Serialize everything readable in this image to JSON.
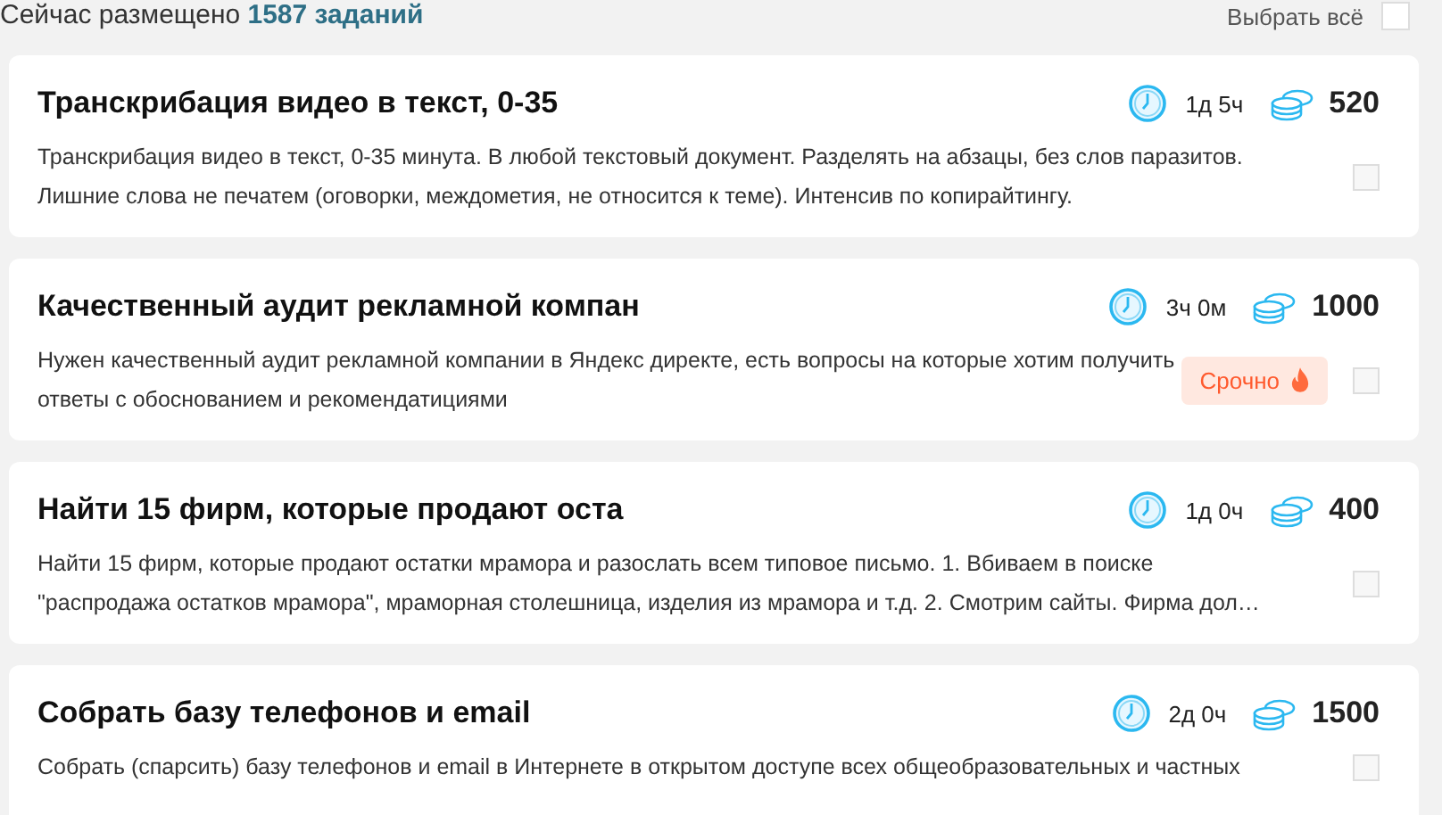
{
  "header": {
    "prefix": "Сейчас размещено",
    "count": "1587 заданий",
    "select_all": {
      "label": "Выбрать всё",
      "checked": false
    }
  },
  "tasks": [
    {
      "title": "Транскрибация видео в текст, 0-35",
      "time": "1д 5ч",
      "price": "520",
      "description": "Транскрибация видео в текст, 0-35 минута. В любой текстовый документ. Разделять на абзацы, без слов паразитов. Лишние слова не печатем (оговорки, междометия, не относится к теме). Интенсив по копирайтингу.",
      "checked": false
    },
    {
      "title": "Качественный аудит рекламной компан",
      "time": "3ч 0м",
      "price": "1000",
      "description": "Нужен качественный аудит рекламной компании в Яндекс директе, есть вопросы на которые хотим получить ответы с обоснованием и рекомендатициями",
      "badge": "Срочно",
      "checked": false
    },
    {
      "title": "Найти 15 фирм, которые продают оста",
      "time": "1д 0ч",
      "price": "400",
      "description": "Найти 15 фирм, которые продают остатки мрамора и разослать всем типовое письмо. 1. Вбиваем в поиске \"распродажа остатков мрамора\", мраморная столешница, изделия из мрамора и т.д. 2. Смотрим сайты. Фирма дол…",
      "checked": false
    },
    {
      "title": "Собрать базу телефонов и email",
      "time": "2д 0ч",
      "price": "1500",
      "description": "Собрать (спарсить) базу телефонов и email в Интернете в открытом доступе всех общеобразовательных и частных",
      "checked": false
    }
  ]
}
